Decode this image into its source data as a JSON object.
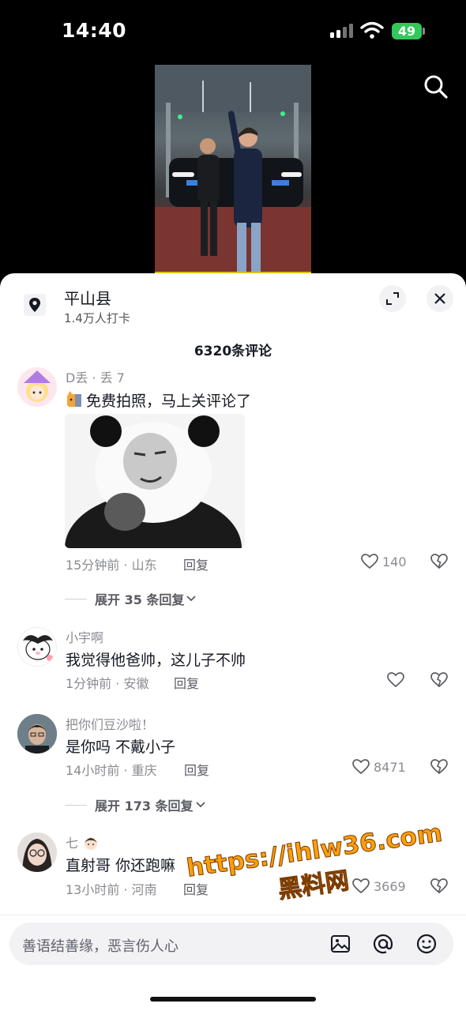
{
  "status_bar": {
    "time": "14:40",
    "battery": "49"
  },
  "location": {
    "title": "平山县",
    "checkins": "1.4万人打卡"
  },
  "comment_count": "6320条评论",
  "comments": [
    {
      "username": "D丢 · 丢 7",
      "text": "免费拍照，马上关评论了",
      "meta": "15分钟前 · 山东",
      "reply": "回复",
      "likes": "140",
      "expand": "展开 35 条回复"
    },
    {
      "username": "小宇啊",
      "text": "我觉得他爸帅，这儿子不帅",
      "meta": "1分钟前 · 安徽",
      "reply": "回复",
      "likes": ""
    },
    {
      "username": "把你们豆沙啦！",
      "text": "是你吗 不戴小子",
      "meta": "14小时前 · 重庆",
      "reply": "回复",
      "likes": "8471",
      "expand": "展开 173 条回复"
    },
    {
      "username": "七",
      "text": "直射哥 你还跑嘛",
      "meta": "13小时前 · 河南",
      "reply": "回复",
      "likes": "3669"
    }
  ],
  "watermark": {
    "url": "https://ihlw36.com",
    "cn": "黑料网"
  },
  "input": {
    "placeholder": "善语结善缘，恶言伤人心"
  },
  "colors": {
    "watermark": "#ff9f0a",
    "battery": "#34c759",
    "sheet": "#ffffff"
  }
}
